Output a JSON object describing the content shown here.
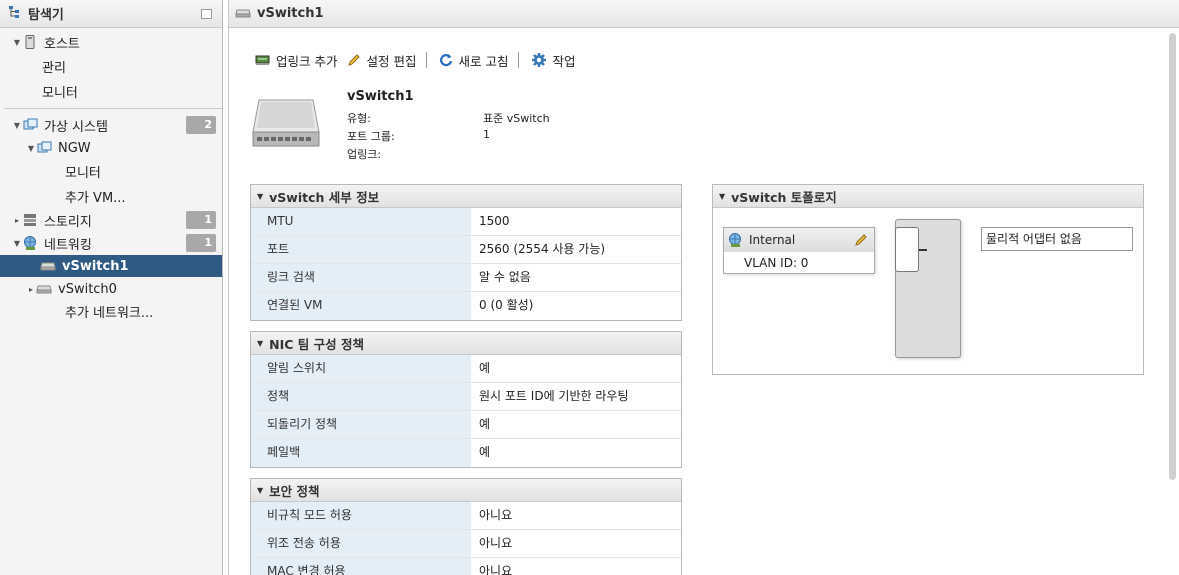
{
  "navigator": {
    "title": "탐색기",
    "items": [
      {
        "label": "호스트"
      },
      {
        "label": "관리"
      },
      {
        "label": "모니터"
      },
      {
        "label": "가상 시스템",
        "badge": "2"
      },
      {
        "label": "NGW"
      },
      {
        "label": "모니터"
      },
      {
        "label": "추가 VM..."
      },
      {
        "label": "스토리지",
        "badge": "1"
      },
      {
        "label": "네트워킹",
        "badge": "1"
      },
      {
        "label": "vSwitch1"
      },
      {
        "label": "vSwitch0"
      },
      {
        "label": "추가 네트워크..."
      }
    ]
  },
  "main": {
    "title": "vSwitch1",
    "toolbar": {
      "add_uplink": "업링크 추가",
      "edit_settings": "설정 편집",
      "refresh": "새로 고침",
      "actions": "작업"
    },
    "info": {
      "name": "vSwitch1",
      "type_label": "유형:",
      "type_value": "표준 vSwitch",
      "portgroups_label": "포트 그룹:",
      "portgroups_value": "1",
      "uplinks_label": "업링크:"
    },
    "details": {
      "title": "vSwitch 세부 정보",
      "rows": [
        {
          "k": "MTU",
          "v": "1500"
        },
        {
          "k": "포트",
          "v": "2560 (2554 사용 가능)"
        },
        {
          "k": "링크 검색",
          "v": "알 수 없음"
        },
        {
          "k": "연결된 VM",
          "v": "0 (0 활성)"
        }
      ]
    },
    "nic": {
      "title": "NIC 팀 구성 정책",
      "rows": [
        {
          "k": "알림 스위치",
          "v": "예"
        },
        {
          "k": "정책",
          "v": "원시 포트 ID에 기반한 라우팅"
        },
        {
          "k": "되돌리기 정책",
          "v": "예"
        },
        {
          "k": "페일백",
          "v": "예"
        }
      ]
    },
    "security": {
      "title": "보안 정책",
      "rows": [
        {
          "k": "비규칙 모드 허용",
          "v": "아니요"
        },
        {
          "k": "위조 전송 허용",
          "v": "아니요"
        },
        {
          "k": "MAC 변경 허용",
          "v": "아니요"
        }
      ]
    },
    "topology": {
      "title": "vSwitch 토폴로지",
      "portgroup_name": "Internal",
      "vlan": "VLAN ID: 0",
      "adapter": "물리적 어댑터 없음"
    }
  },
  "colors": {
    "selected": "#2f5a84",
    "key_bg": "#e4eef7",
    "badge": "#a8a8a8"
  }
}
